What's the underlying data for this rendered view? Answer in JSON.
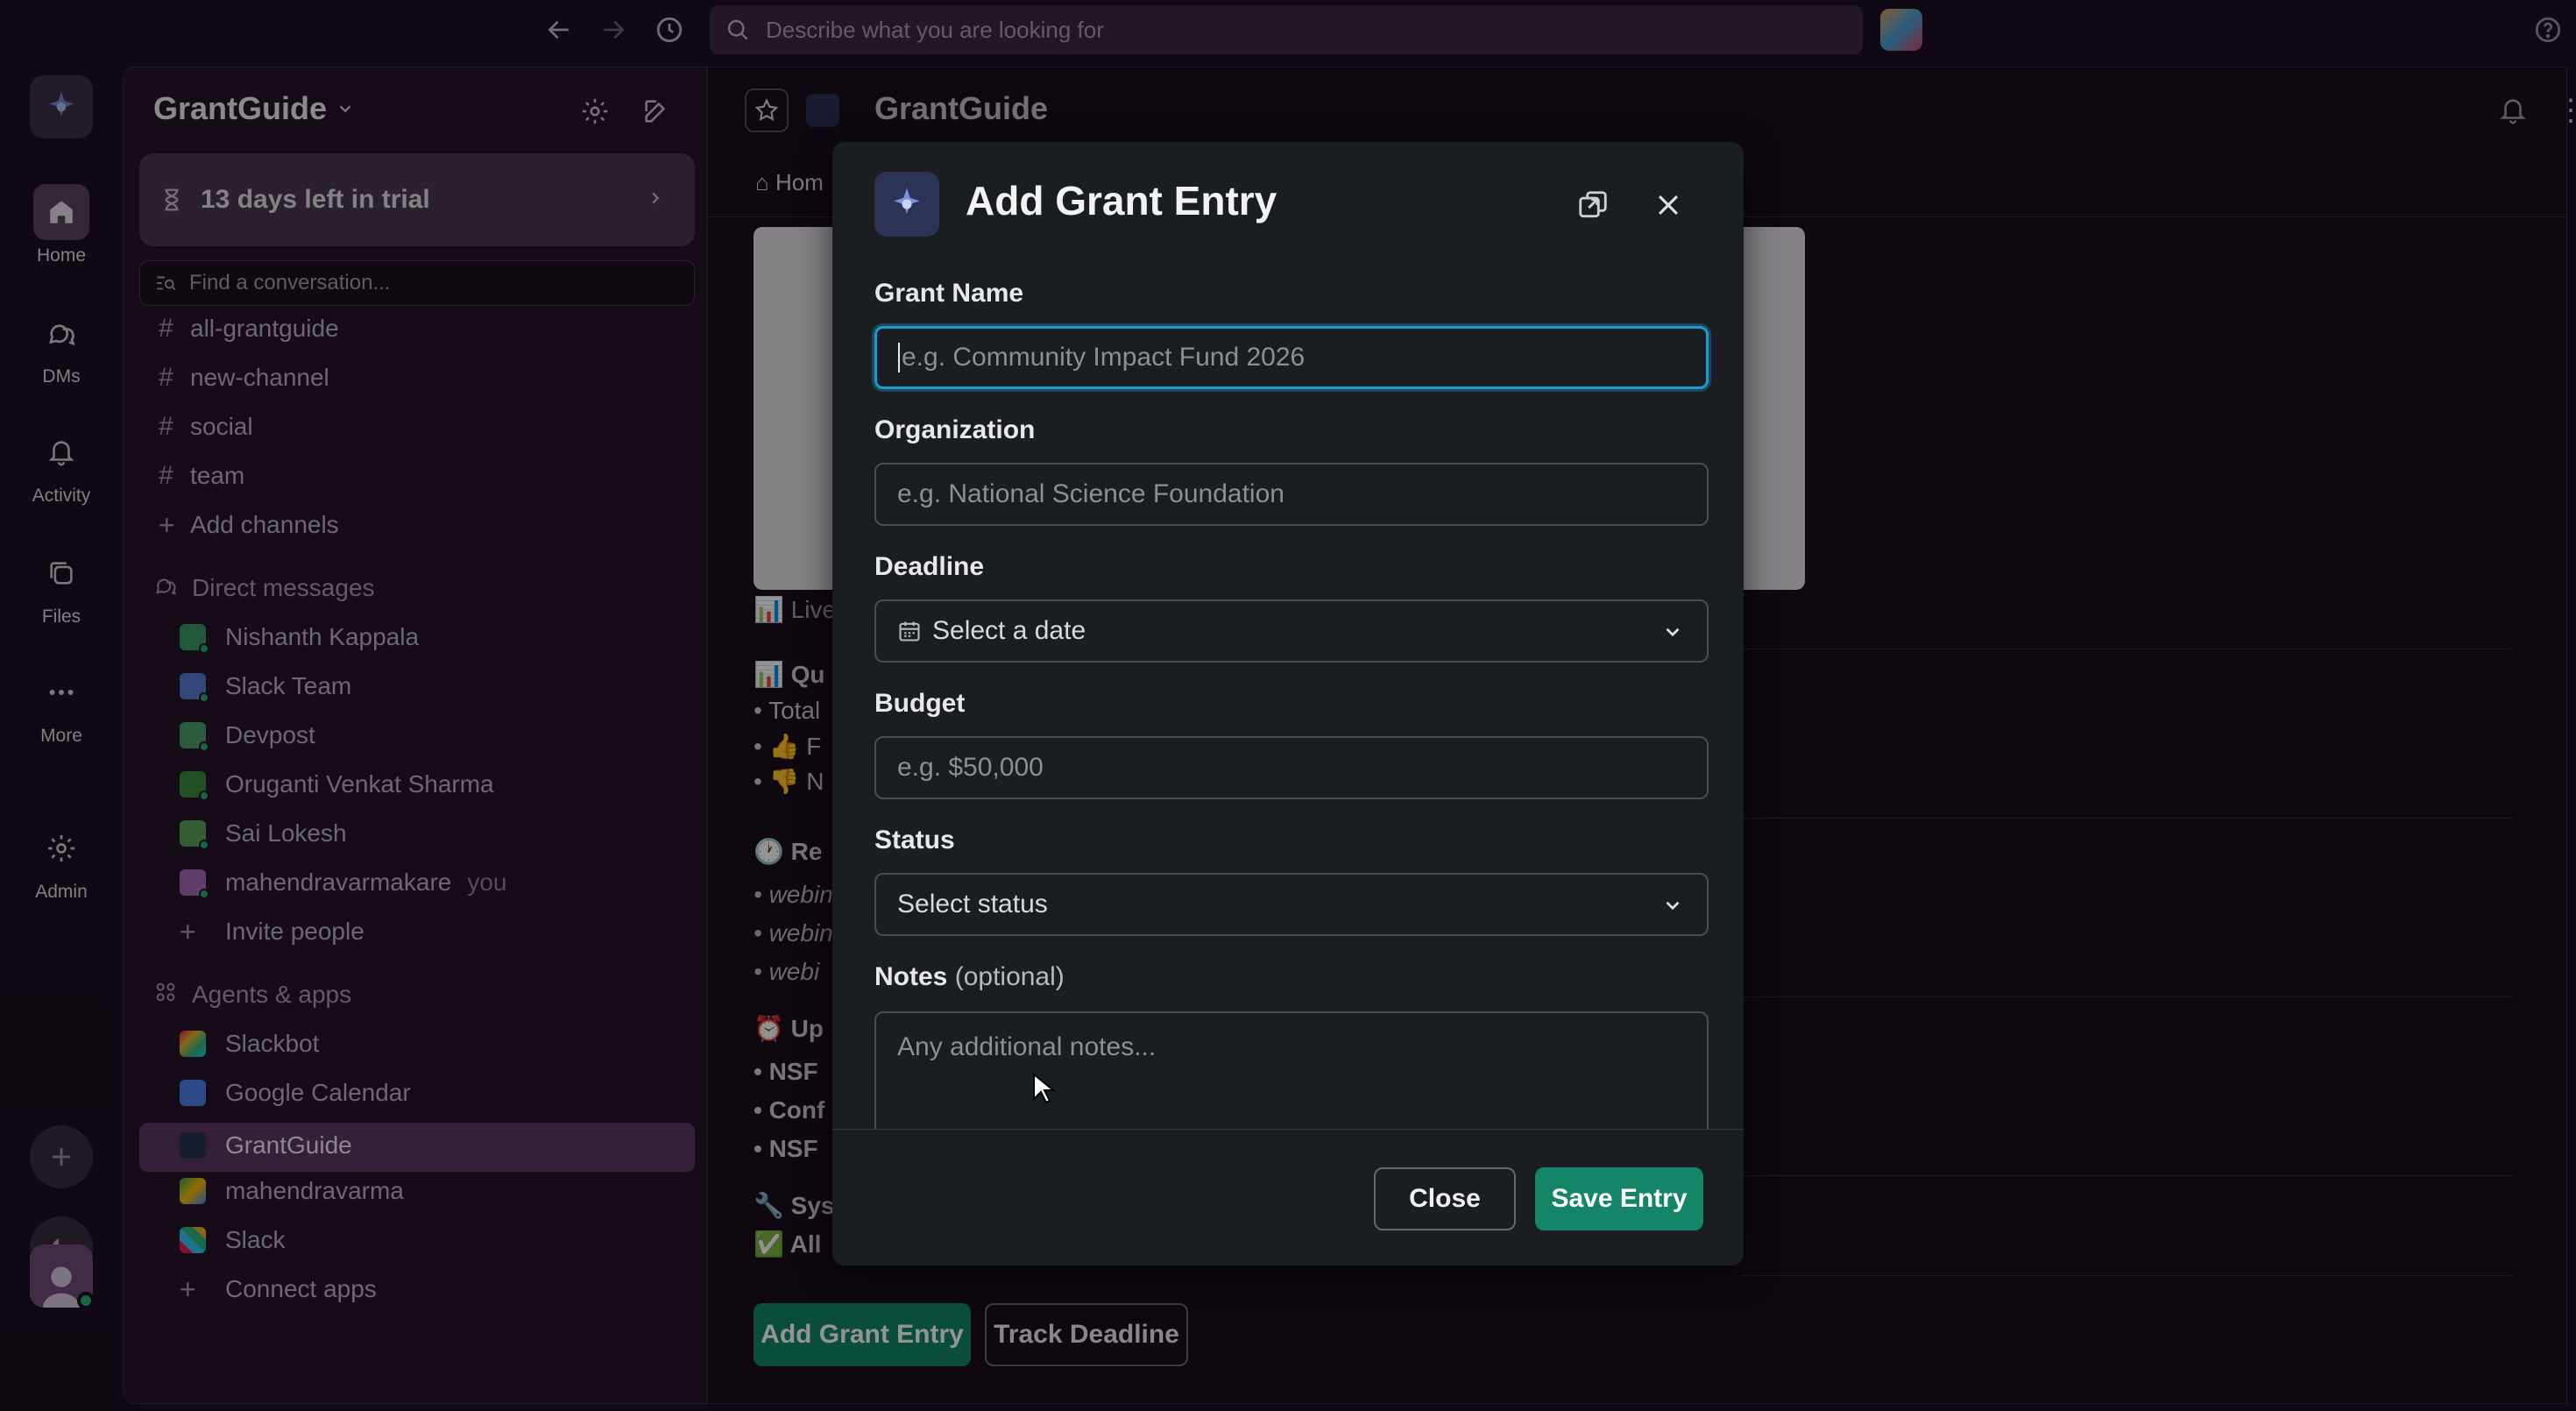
{
  "topbar": {
    "search_placeholder": "Describe what you are looking for",
    "icons": [
      "back-arrow-icon",
      "forward-arrow-icon",
      "history-icon",
      "search-icon",
      "help-icon"
    ]
  },
  "rail": {
    "items": [
      {
        "label": "Home",
        "icon": "home-icon",
        "active": true
      },
      {
        "label": "DMs",
        "icon": "dms-icon"
      },
      {
        "label": "Activity",
        "icon": "bell-icon"
      },
      {
        "label": "Files",
        "icon": "files-icon"
      },
      {
        "label": "More",
        "icon": "more-icon"
      },
      {
        "label": "Admin",
        "icon": "gear-icon"
      }
    ]
  },
  "sidebar": {
    "workspace_name": "GrantGuide",
    "trial_text": "13 days left in trial",
    "find_placeholder": "Find a conversation...",
    "channels": [
      "all-grantguide",
      "new-channel",
      "social",
      "team"
    ],
    "add_channels": "Add channels",
    "dm_header": "Direct messages",
    "dms": [
      {
        "name": "Nishanth Kappala",
        "color": "#3c9a6a"
      },
      {
        "name": "Slack Team",
        "color": "#5a7bd8"
      },
      {
        "name": "Devpost",
        "color": "#4e9e6c"
      },
      {
        "name": "Oruganti Venkat Sharma",
        "color": "#3a8a3e"
      },
      {
        "name": "Sai Lokesh",
        "color": "#5ea35c"
      },
      {
        "name": "mahendravarmakare",
        "color": "#a869b8",
        "suffix": "you"
      }
    ],
    "invite_people": "Invite people",
    "apps_header": "Agents & apps",
    "apps": [
      "Slackbot",
      "Google Calendar",
      "GrantGuide",
      "mahendravarma",
      "Slack"
    ],
    "connect_apps": "Connect apps"
  },
  "channel": {
    "title": "GrantGuide",
    "tab": "Hom",
    "line_live": "Live",
    "line_quick": "Qu",
    "line_total": "• Total",
    "line_p": "F",
    "line_n": "N",
    "line_recent": "Re",
    "webinars": [
      "• webin",
      "• webin",
      "• webi"
    ],
    "line_upcoming": "Up",
    "upcoming": [
      "• NSF",
      "• Conf",
      "• NSF"
    ],
    "line_system": "Sys",
    "line_all": "All",
    "add_grant_btn": "Add Grant Entry",
    "track_deadline_btn": "Track Deadline"
  },
  "modal": {
    "title": "Add Grant Entry",
    "fields": {
      "grant_name": {
        "label": "Grant Name",
        "placeholder": "e.g. Community Impact Fund 2026"
      },
      "organization": {
        "label": "Organization",
        "placeholder": "e.g. National Science Foundation"
      },
      "deadline": {
        "label": "Deadline",
        "placeholder": "Select a date"
      },
      "budget": {
        "label": "Budget",
        "placeholder": "e.g. $50,000"
      },
      "status": {
        "label": "Status",
        "placeholder": "Select status"
      },
      "notes": {
        "label": "Notes",
        "optional": "(optional)",
        "placeholder": "Any additional notes..."
      }
    },
    "close_label": "Close",
    "save_label": "Save Entry"
  }
}
